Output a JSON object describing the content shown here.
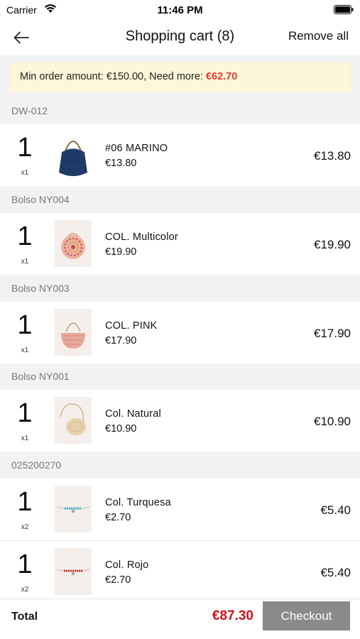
{
  "status_bar": {
    "carrier": "Carrier",
    "time": "11:46 PM"
  },
  "nav": {
    "title": "Shopping cart (8)",
    "remove_all": "Remove all"
  },
  "notice": {
    "prefix": "Min order amount: €150.00, Need more: ",
    "amount": "€62.70"
  },
  "groups": [
    {
      "label": "DW-012",
      "items": [
        {
          "qty": "1",
          "mult": "x1",
          "name": "#06 MARINO",
          "unit_price": "€13.80",
          "total": "€13.80",
          "image": "navy-hobo-bag"
        }
      ]
    },
    {
      "label": "Bolso NY004",
      "items": [
        {
          "qty": "1",
          "mult": "x1",
          "name": "COL. Multicolor",
          "unit_price": "€19.90",
          "total": "€19.90",
          "image": "round-multicolor-straw-bag"
        }
      ]
    },
    {
      "label": "Bolso NY003",
      "items": [
        {
          "qty": "1",
          "mult": "x1",
          "name": "COL. PINK",
          "unit_price": "€17.90",
          "total": "€17.90",
          "image": "pink-halfmoon-straw-bag"
        }
      ]
    },
    {
      "label": "Bolso NY001",
      "items": [
        {
          "qty": "1",
          "mult": "x1",
          "name": "Col. Natural",
          "unit_price": "€10.90",
          "total": "€10.90",
          "image": "natural-round-crossbody-bag"
        }
      ]
    },
    {
      "label": "025200270",
      "items": [
        {
          "qty": "1",
          "mult": "x2",
          "name": "Col. Turquesa",
          "unit_price": "€2.70",
          "total": "€5.40",
          "image": "turquoise-bead-bracelet"
        },
        {
          "qty": "1",
          "mult": "x2",
          "name": "Col. Rojo",
          "unit_price": "€2.70",
          "total": "€5.40",
          "image": "red-bead-bracelet"
        }
      ]
    }
  ],
  "footer": {
    "total_label": "Total",
    "total_value": "€87.30",
    "checkout_label": "Checkout"
  },
  "colors": {
    "accent_red": "#d0121b",
    "notice_bg": "#fdf6d8",
    "checkout_bg": "#8a8a8a"
  },
  "icons": {
    "back": "arrow-left-icon",
    "wifi": "wifi-icon",
    "battery": "battery-icon"
  }
}
